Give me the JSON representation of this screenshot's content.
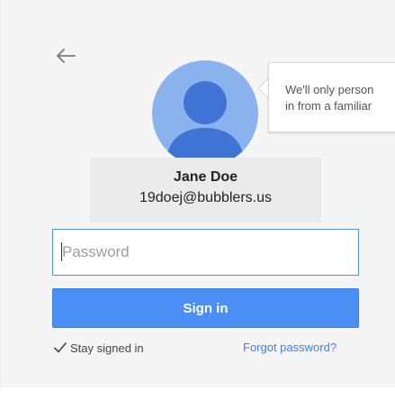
{
  "tooltip": {
    "line1": "We'll only person",
    "line2": "in from a familiar"
  },
  "account": {
    "name": "Jane Doe",
    "email": "19doej@bubblers.us"
  },
  "form": {
    "password_placeholder": "Password",
    "signin_label": "Sign in",
    "stay_signed_in_label": "Stay signed in",
    "stay_signed_in_checked": true,
    "forgot_label": "Forgot password?"
  },
  "icons": {
    "back": "back-arrow-icon",
    "avatar": "default-avatar-icon",
    "check": "checkmark-icon"
  },
  "colors": {
    "accent": "#4b8ff5",
    "link": "#427fed",
    "avatar_bg": "#8ab3ee",
    "avatar_figure": "#3f74d4",
    "input_focus_border": "#4d90fe"
  }
}
